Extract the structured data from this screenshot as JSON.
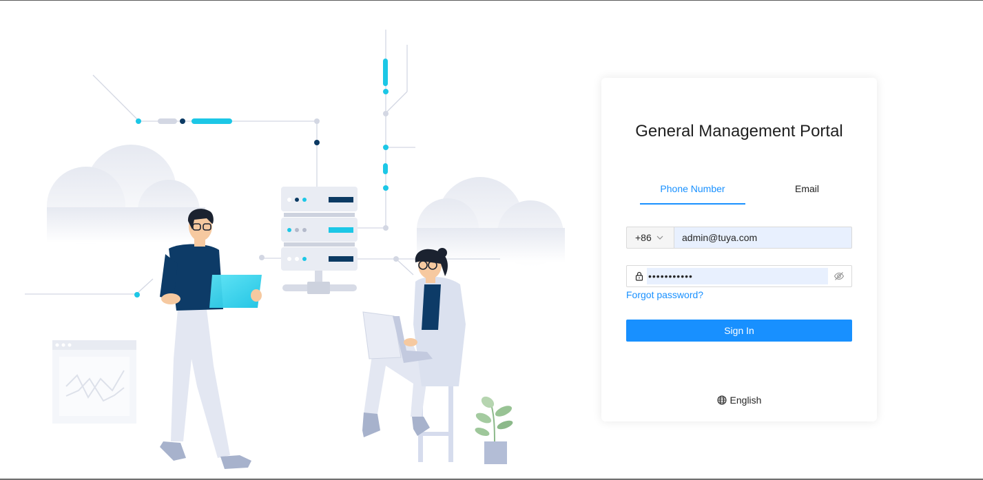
{
  "portal": {
    "title": "General Management Portal"
  },
  "tabs": [
    {
      "label": "Phone Number",
      "active": true
    },
    {
      "label": "Email",
      "active": false
    }
  ],
  "phone": {
    "country_code": "+86",
    "value": "admin@tuya.com"
  },
  "password": {
    "masked_value": "•••••••••••"
  },
  "links": {
    "forgot_password": "Forgot password?"
  },
  "buttons": {
    "sign_in": "Sign In"
  },
  "language": {
    "current": "English"
  },
  "icons": {
    "chevron": "chevron-down-icon",
    "lock": "lock-icon",
    "eye": "eye-invisible-icon",
    "globe": "globe-icon"
  },
  "colors": {
    "primary": "#1890ff",
    "accent_cyan": "#1cc7e6",
    "navy": "#0b3a63",
    "autofill_bg": "#e8f0fe"
  }
}
